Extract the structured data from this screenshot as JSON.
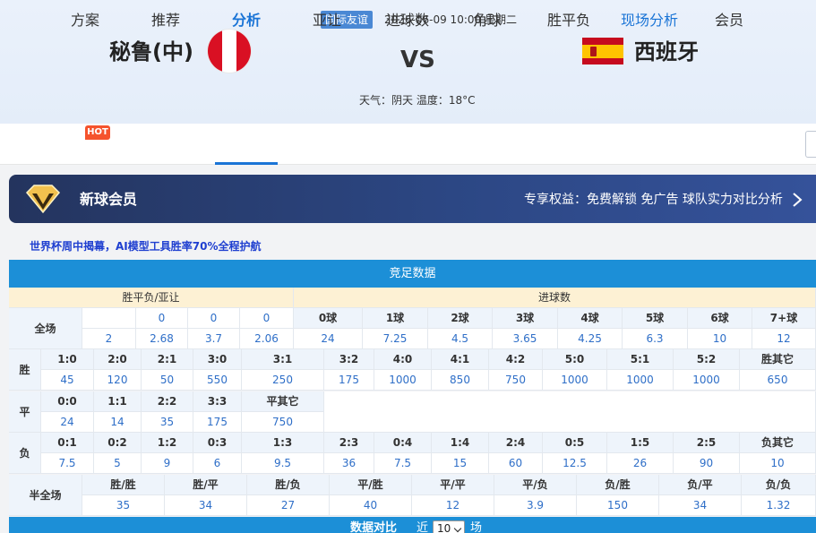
{
  "header": {
    "league": "国际友谊",
    "time": "2026-06-09 10:00 星期二",
    "home_team": "秘鲁(中)",
    "away_team": "西班牙",
    "vs": "VS",
    "weather": "天气：阴天 温度：18°C",
    "home_flag_icon": "peru-flag-icon",
    "away_flag_icon": "spain-flag-icon"
  },
  "nav": {
    "hot_badge": "HOT",
    "items": [
      "方案",
      "推荐",
      "分析",
      "亚让",
      "进球数",
      "角球",
      "胜平负",
      "现场分析",
      "会员"
    ],
    "active_index": 2,
    "highlight_index": 7
  },
  "vip": {
    "title": "新球会员",
    "rights": "专享权益：免费解锁 免广告 球队实力对比分析",
    "icon": "diamond-v-icon"
  },
  "promo": "世界杯周中揭幕，AI模型工具胜率70%全程护航",
  "section_title": "竞足数据",
  "odds": {
    "wdl_header": "胜平负/亚让",
    "goals_header": "进球数",
    "full_label": "全场",
    "wdl_top": [
      "",
      "0",
      "0",
      "0"
    ],
    "wdl_bottom": [
      "2",
      "2.68",
      "3.7",
      "2.06"
    ],
    "goals_labels": [
      "0球",
      "1球",
      "2球",
      "3球",
      "4球",
      "5球",
      "6球",
      "7+球"
    ],
    "goals_values": [
      "24",
      "7.25",
      "4.5",
      "3.65",
      "4.25",
      "6.3",
      "10",
      "12"
    ]
  },
  "score": {
    "win_label": "胜",
    "draw_label": "平",
    "lose_label": "负",
    "win_scores": [
      "1:0",
      "2:0",
      "2:1",
      "3:0",
      "3:1",
      "3:2",
      "4:0",
      "4:1",
      "4:2",
      "5:0",
      "5:1",
      "5:2",
      "胜其它"
    ],
    "win_odds": [
      "45",
      "120",
      "50",
      "550",
      "250",
      "175",
      "1000",
      "850",
      "750",
      "1000",
      "1000",
      "1000",
      "650"
    ],
    "draw_scores": [
      "0:0",
      "1:1",
      "2:2",
      "3:3",
      "平其它"
    ],
    "draw_odds": [
      "24",
      "14",
      "35",
      "175",
      "750"
    ],
    "lose_scores": [
      "0:1",
      "0:2",
      "1:2",
      "0:3",
      "1:3",
      "2:3",
      "0:4",
      "1:4",
      "2:4",
      "0:5",
      "1:5",
      "2:5",
      "负其它"
    ],
    "lose_odds": [
      "7.5",
      "5",
      "9",
      "6",
      "9.5",
      "36",
      "7.5",
      "15",
      "60",
      "12.5",
      "26",
      "90",
      "10"
    ]
  },
  "halffull": {
    "label": "半全场",
    "headers": [
      "胜/胜",
      "胜/平",
      "胜/负",
      "平/胜",
      "平/平",
      "平/负",
      "负/胜",
      "负/平",
      "负/负"
    ],
    "values": [
      "35",
      "34",
      "27",
      "40",
      "12",
      "3.9",
      "150",
      "34",
      "1.32"
    ]
  },
  "bottom": {
    "title": "数据对比",
    "near": "近",
    "select_value": "10",
    "unit": "场"
  }
}
